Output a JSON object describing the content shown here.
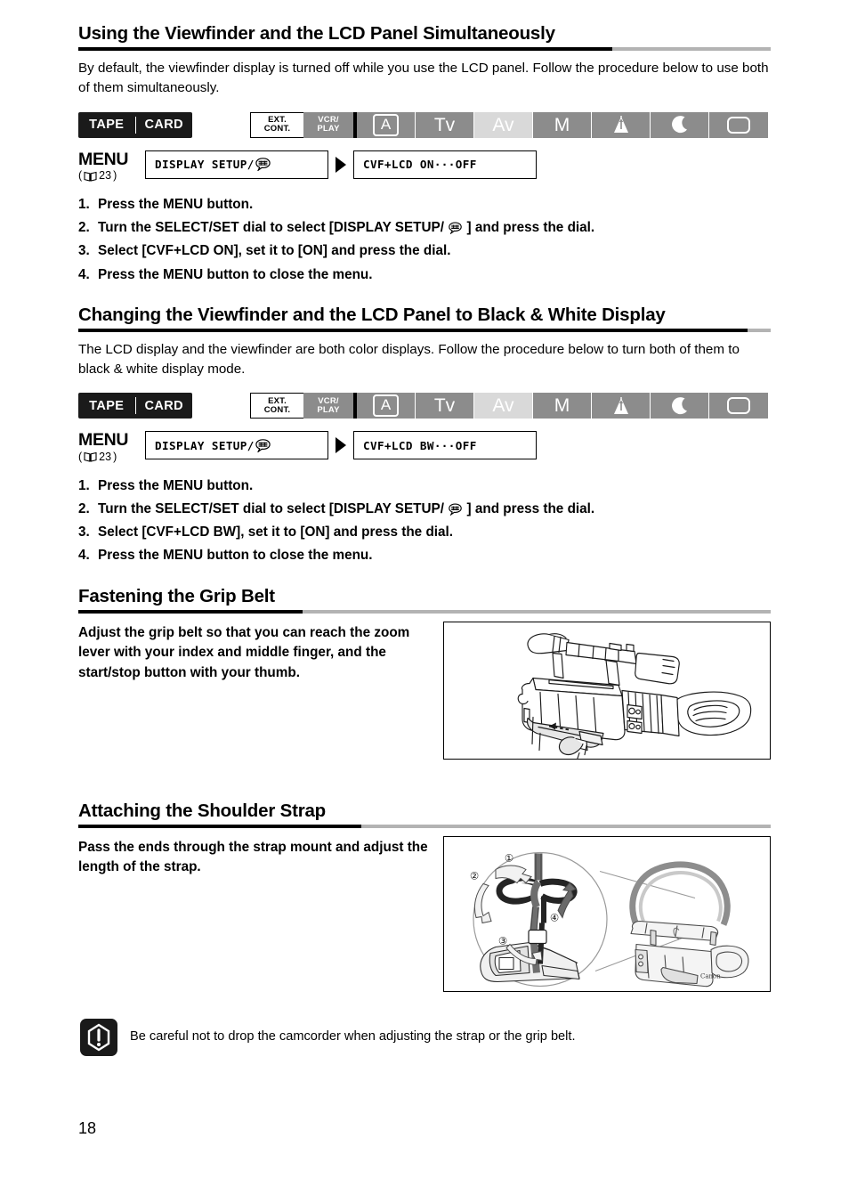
{
  "page": {
    "number": "18"
  },
  "sections": [
    {
      "heading": "Using the Viewfinder and the LCD Panel Simultaneously",
      "body": "By default, the viewfinder display is turned off while you use the LCD panel. Follow the procedure below to use both of them simultaneously.",
      "media": {
        "tape": "TAPE",
        "card": "CARD"
      },
      "modes": [
        {
          "label": "EXT.\nCONT.",
          "name": "mode-ext-cont",
          "style": "white"
        },
        {
          "label": "VCR/\nPLAY",
          "name": "mode-vcr-play",
          "style": "gray"
        },
        {
          "label": "A",
          "name": "mode-auto",
          "style": "gray-boxed"
        },
        {
          "label": "Tv",
          "name": "mode-tv",
          "style": "gray"
        },
        {
          "label": "Av",
          "name": "mode-av",
          "style": "active"
        },
        {
          "label": "M",
          "name": "mode-manual",
          "style": "gray"
        },
        {
          "label": "spotlight-icon",
          "name": "mode-spotlight",
          "style": "icon"
        },
        {
          "label": "moon-icon",
          "name": "mode-night",
          "style": "icon"
        },
        {
          "label": "rect-icon",
          "name": "mode-card-rec",
          "style": "icon"
        }
      ],
      "menu": {
        "label": "MENU",
        "page_ref": "23",
        "box1": "DISPLAY SETUP/",
        "box2": "CVF+LCD ON···OFF"
      },
      "steps": [
        {
          "num": "1.",
          "pre": "Press the MENU button.",
          "post": ""
        },
        {
          "num": "2.",
          "pre": "Turn the SELECT/SET dial to select [DISPLAY SETUP/",
          "post": "] and press the dial."
        },
        {
          "num": "3.",
          "pre": "Select [CVF+LCD ON], set it to [ON] and press the dial.",
          "post": ""
        },
        {
          "num": "4.",
          "pre": "Press the MENU button to close the menu.",
          "post": ""
        }
      ]
    },
    {
      "heading": "Changing the Viewfinder and the LCD Panel to Black & White Display",
      "body": "The LCD display and the viewfinder are both color displays. Follow the procedure below to turn both of them to black & white display mode.",
      "media": {
        "tape": "TAPE",
        "card": "CARD"
      },
      "modes": [
        {
          "label": "EXT.\nCONT.",
          "name": "mode-ext-cont",
          "style": "white"
        },
        {
          "label": "VCR/\nPLAY",
          "name": "mode-vcr-play",
          "style": "gray"
        },
        {
          "label": "A",
          "name": "mode-auto",
          "style": "gray-boxed"
        },
        {
          "label": "Tv",
          "name": "mode-tv",
          "style": "gray"
        },
        {
          "label": "Av",
          "name": "mode-av",
          "style": "active"
        },
        {
          "label": "M",
          "name": "mode-manual",
          "style": "gray"
        },
        {
          "label": "spotlight-icon",
          "name": "mode-spotlight",
          "style": "icon"
        },
        {
          "label": "moon-icon",
          "name": "mode-night",
          "style": "icon"
        },
        {
          "label": "rect-icon",
          "name": "mode-card-rec",
          "style": "icon"
        }
      ],
      "menu": {
        "label": "MENU",
        "page_ref": "23",
        "box1": "DISPLAY SETUP/",
        "box2": "CVF+LCD BW···OFF"
      },
      "steps": [
        {
          "num": "1.",
          "pre": "Press the MENU button.",
          "post": ""
        },
        {
          "num": "2.",
          "pre": "Turn the SELECT/SET dial to select [DISPLAY SETUP/",
          "post": "] and press the dial."
        },
        {
          "num": "3.",
          "pre": "Select [CVF+LCD BW], set it to [ON] and press the dial.",
          "post": ""
        },
        {
          "num": "4.",
          "pre": "Press the MENU button to close the menu.",
          "post": ""
        }
      ]
    }
  ],
  "grip": {
    "heading": "Fastening the Grip Belt",
    "text": "Adjust the grip belt so that you can reach the zoom lever with your index and middle finger, and the start/stop button with your thumb.",
    "figure": "camcorder-grip-belt-illustration"
  },
  "strap": {
    "heading": "Attaching the Shoulder Strap",
    "text": "Pass the ends through the strap mount and adjust the length of the strap.",
    "figure": "shoulder-strap-attachment-illustration",
    "callouts": [
      "①",
      "②",
      "③",
      "④"
    ]
  },
  "note": {
    "icon": "warning-exclamation-icon",
    "text": "Be careful not to drop the camcorder when adjusting the strap or the grip belt."
  },
  "colors": {
    "rule_gray": "#b3b3b3",
    "mode_gray": "#8c8c8c",
    "mode_active": "#d9d9d9",
    "badge_black": "#1a1a1a"
  }
}
